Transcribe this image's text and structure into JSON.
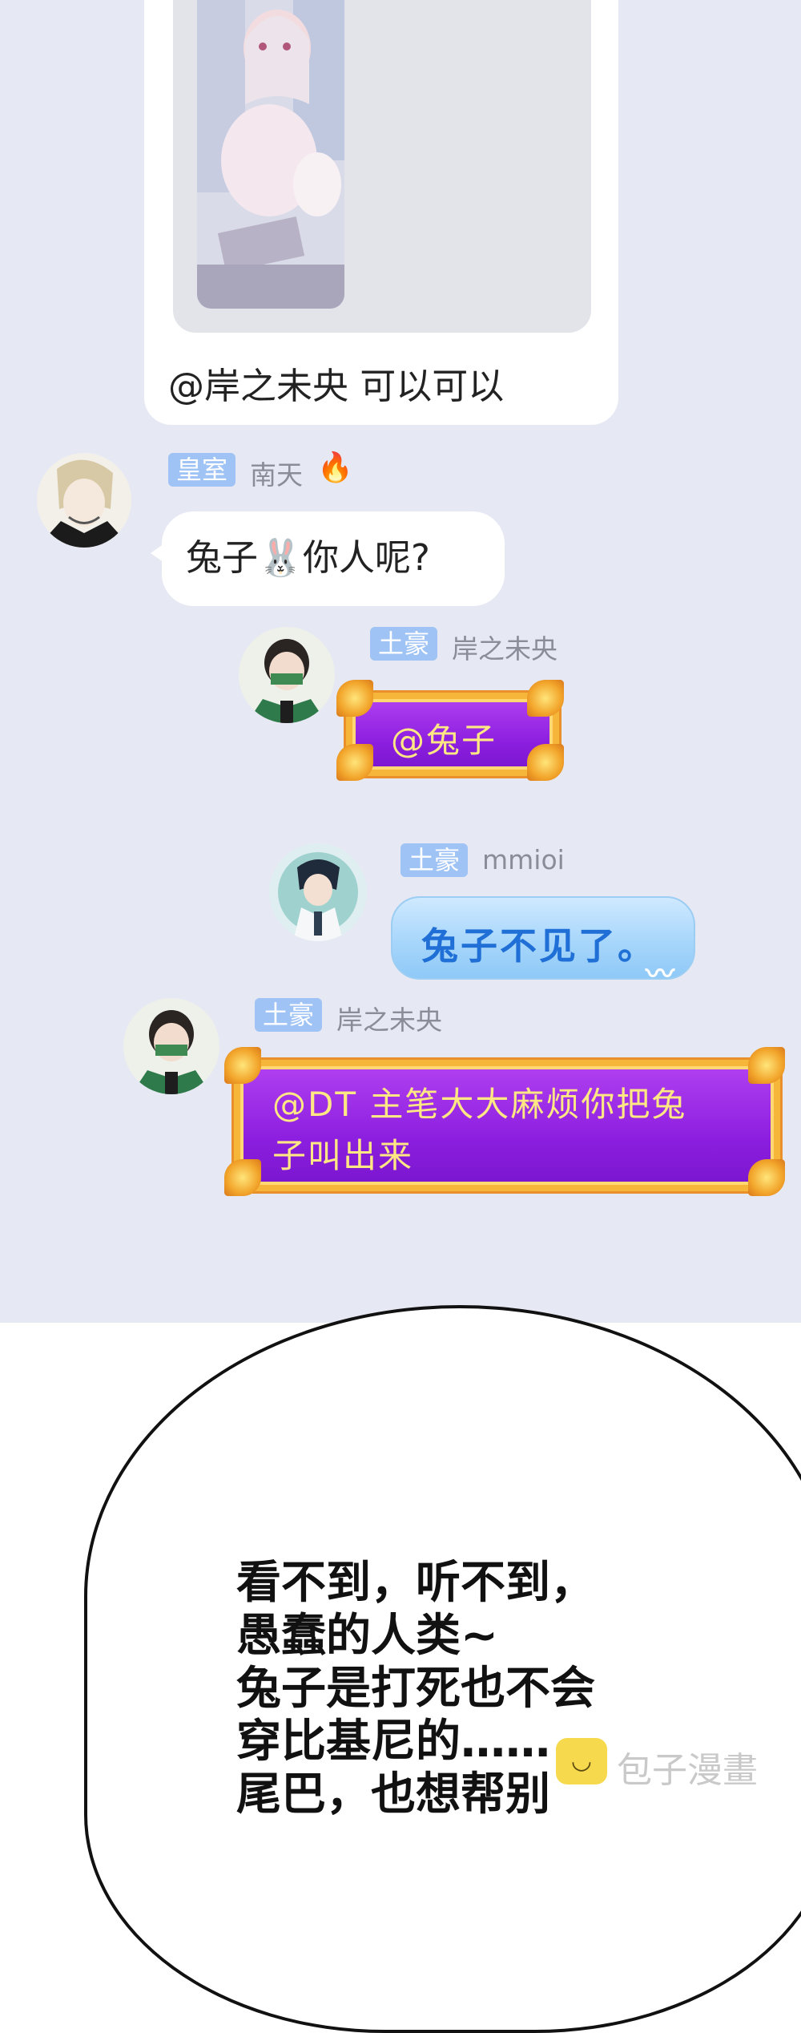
{
  "post": {
    "caption": "@岸之未央 可以可以"
  },
  "messages": [
    {
      "tag": "皇室",
      "nick": "南天",
      "nick_icon": "fire-icon",
      "icon_glyph": "🔥",
      "text": "兔子🐰你人呢?"
    },
    {
      "tag": "土豪",
      "nick": "岸之未央",
      "text": "@兔子"
    },
    {
      "tag": "土豪",
      "nick": "mmioi",
      "text": "兔子不见了。"
    },
    {
      "tag": "土豪",
      "nick": "岸之未央",
      "text_line1": "@DT 主笔大大麻烦你把兔",
      "text_line2": "子叫出来"
    }
  ],
  "speech": {
    "line1": "看不到，听不到，",
    "line2": "愚蠢的人类~",
    "line3": "兔子是打死也不会",
    "line4": "穿比基尼的……",
    "line5": "尾巴，也想帮别"
  },
  "watermark": {
    "text": "包子漫畫",
    "icon": "bun-icon"
  },
  "colors": {
    "chat_background": "#e6e9f3",
    "tag_background": "#9fc3f5",
    "purple_bubble": "#8d1fe0",
    "gold_frame": "#f5b63a",
    "blue_bubble_text": "#1f6fd6"
  }
}
